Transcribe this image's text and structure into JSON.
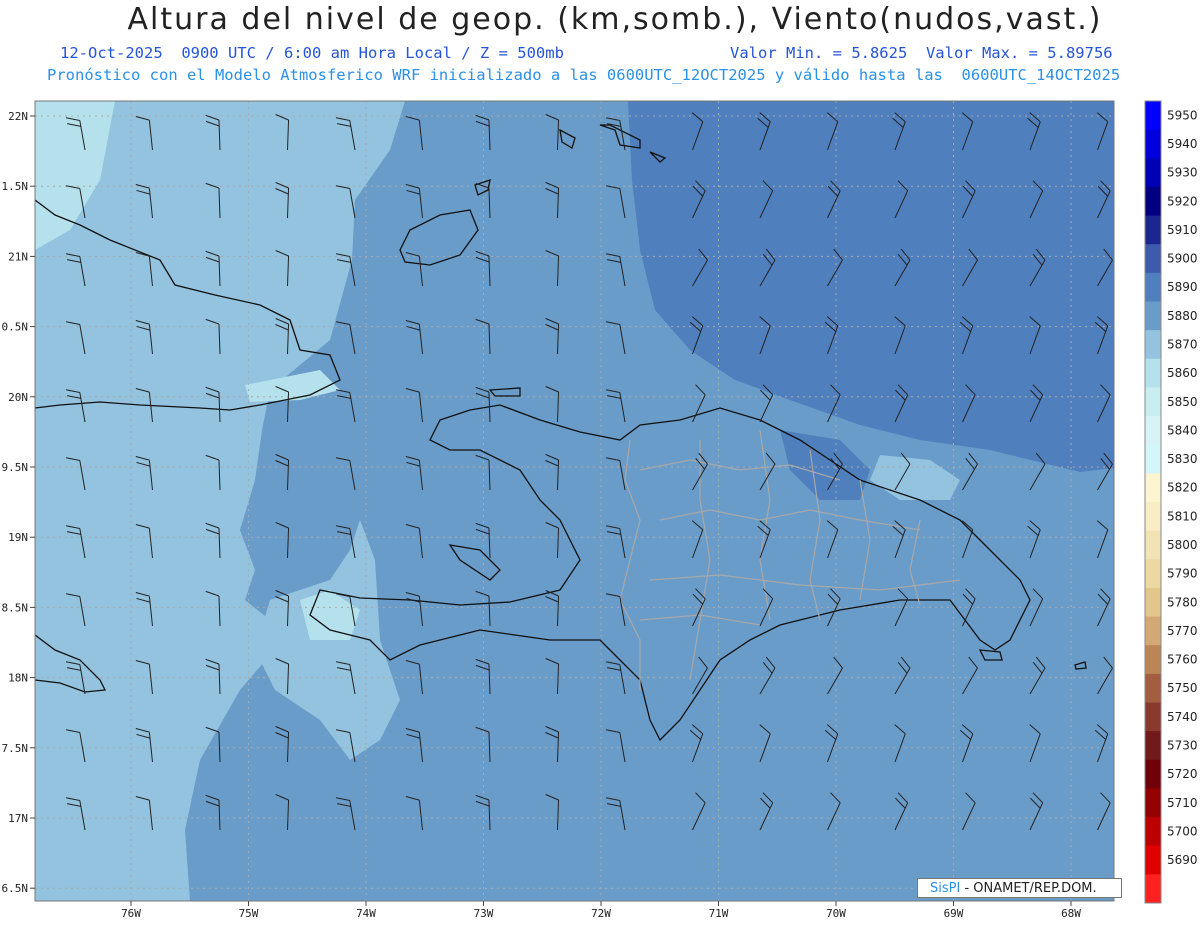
{
  "header": {
    "title": "Altura del nivel de geop. (km,somb.), Viento(nudos,vast.)",
    "date_line": "12-Oct-2025  0900 UTC / 6:00 am Hora Local / Z = 500mb",
    "minmax_line": "Valor Min. = 5.8625  Valor Max. = 5.89756",
    "model_line": "Pronóstico con el Modelo Atmosferico WRF inicializado a las 0600UTC_12OCT2025 y válido hasta las  0600UTC_14OCT2025"
  },
  "map": {
    "lat_labels": [
      "22N",
      "1.5N",
      "21N",
      "0.5N",
      "20N",
      "9.5N",
      "19N",
      "8.5N",
      "18N",
      "7.5N",
      "17N",
      "6.5N"
    ],
    "lon_labels": [
      "76W",
      "75W",
      "74W",
      "73W",
      "72W",
      "71W",
      "70W",
      "69W",
      "68W"
    ]
  },
  "colorbar": {
    "levels": [
      "5950",
      "5940",
      "5930",
      "5920",
      "5910",
      "5900",
      "5890",
      "5880",
      "5870",
      "5860",
      "5850",
      "5840",
      "5830",
      "5820",
      "5810",
      "5800",
      "5790",
      "5780",
      "5770",
      "5760",
      "5750",
      "5740",
      "5730",
      "5720",
      "5710",
      "5700",
      "5690"
    ],
    "colors": [
      "#0000ff",
      "#0000dd",
      "#0000b4",
      "#000080",
      "#1c2690",
      "#3d5aad",
      "#4f7fbd",
      "#6a9cc9",
      "#93c3df",
      "#b4e1ec",
      "#c8eef2",
      "#d8f3f6",
      "#d2f6fa",
      "#fdf5d2",
      "#f8edc5",
      "#f1e3b3",
      "#ecd9a1",
      "#e3c68b",
      "#d3a874",
      "#bc8556",
      "#a35d3f",
      "#8a3a2c",
      "#72191c",
      "#700009",
      "#940000",
      "#bc0000",
      "#e10000",
      "#ff2020"
    ]
  },
  "credit": {
    "brand": "SisPI",
    "org": " - ONAMET/REP.DOM."
  }
}
